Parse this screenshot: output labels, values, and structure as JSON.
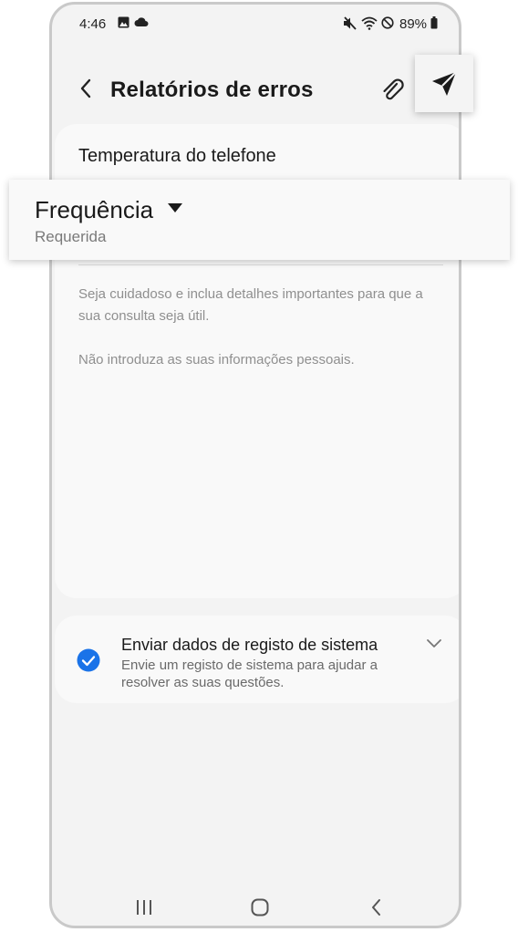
{
  "status_bar": {
    "time": "4:46",
    "battery": "89%",
    "icons": [
      "image-icon",
      "cloud-icon",
      "mute-icon",
      "wifi-icon",
      "do-not-disturb-icon",
      "battery-icon"
    ]
  },
  "header": {
    "title": "Relatórios de erros",
    "back_icon": "back-arrow-icon",
    "attach_icon": "paperclip-icon",
    "send_icon": "send-icon"
  },
  "form": {
    "topic": "Temperatura do telefone",
    "frequency_label": "Frequência",
    "frequency_required": "Requerida",
    "hint_1": "Seja cuidadoso e inclua detalhes importantes para que a sua consulta seja útil.",
    "hint_2": "Não introduza as suas informações pessoais."
  },
  "system_log": {
    "title": "Enviar dados de registo de sistema",
    "description": "Envie um registo de sistema para ajudar a resolver as suas questões.",
    "checked": true
  },
  "colors": {
    "accent": "#1a73e8",
    "background": "#f3f3f3",
    "card": "#f9f9f9"
  },
  "nav_bar": [
    "recents-icon",
    "home-icon",
    "back-icon"
  ]
}
